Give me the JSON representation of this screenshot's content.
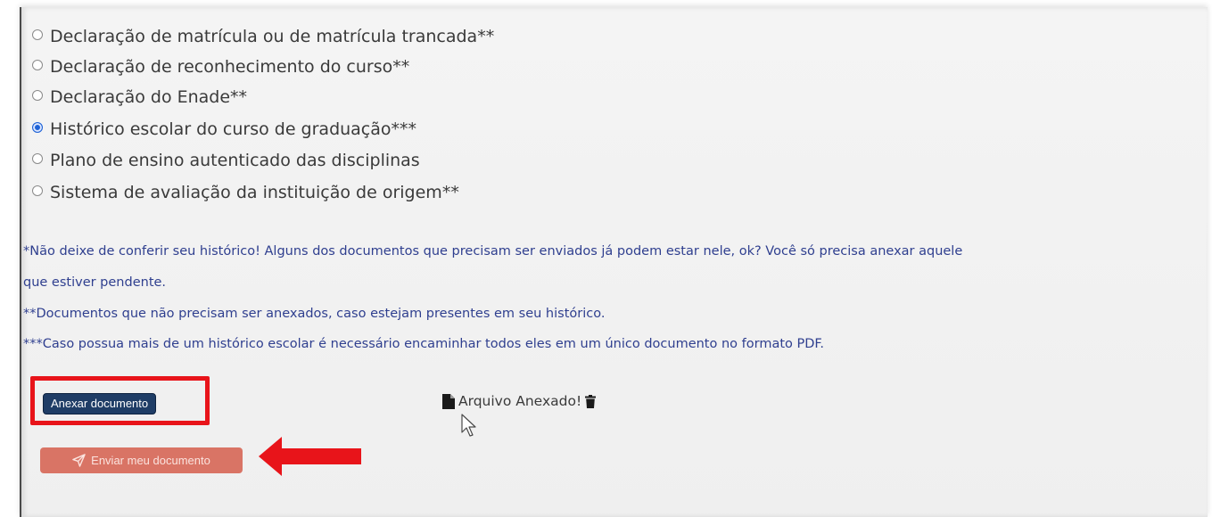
{
  "options": [
    {
      "label": "Declaração de matrícula ou de matrícula trancada**",
      "selected": false
    },
    {
      "label": "Declaração de reconhecimento do curso**",
      "selected": false
    },
    {
      "label": "Declaração do Enade**",
      "selected": false
    },
    {
      "label": "Histórico escolar do curso de graduação***",
      "selected": true
    },
    {
      "label": "Plano de ensino autenticado das disciplinas",
      "selected": false
    },
    {
      "label": "Sistema de avaliação da instituição de origem**",
      "selected": false
    }
  ],
  "notes": {
    "note1_line1": "*Não deixe de conferir seu histórico! Alguns dos documentos que precisam ser enviados já podem estar nele, ok? Você só precisa anexar aquele",
    "note1_line2": "que estiver pendente.",
    "note2": "**Documentos que não precisam ser anexados, caso estejam presentes em seu histórico.",
    "note3": "***Caso possua mais de um histórico escolar é necessário encaminhar todos eles em um único documento no formato PDF."
  },
  "actions": {
    "attach_label": "Anexar documento",
    "send_label": "Enviar meu documento",
    "attached_status": "Arquivo Anexado!"
  },
  "colors": {
    "highlight_red": "#e8141a",
    "attach_button": "#1f3d66",
    "send_button": "#d97465",
    "note_text": "#2f3f8f",
    "radio_selected": "#1f63d6"
  },
  "icons": {
    "send": "paper-plane-icon",
    "attached": "file-icon",
    "delete": "trash-icon",
    "annotation": "red-arrow-icon",
    "pointer": "mouse-cursor-icon"
  }
}
